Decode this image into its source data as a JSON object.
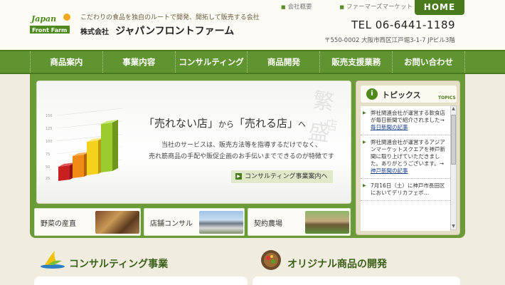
{
  "header": {
    "logo_text_top": "Japan",
    "logo_text_bottom": "Front Farm",
    "tagline": "こだわりの食品を独自のルートで開発、開拓して販売する会社",
    "company_prefix": "株式会社",
    "company_name": "ジャパンフロントファーム",
    "top_links": [
      "会社概要",
      "ファーマーズマーケット"
    ],
    "home": "HOME",
    "tel": "TEL 06-6441-1189",
    "address": "〒550-0002 大阪市西区江戸堀3-1-7 JPビル3階"
  },
  "nav": {
    "items": [
      "商品案内",
      "事業内容",
      "コンサルティング",
      "商品開発",
      "販売支援業務",
      "お問い合わせ"
    ]
  },
  "hero": {
    "stamp": "繁盛",
    "stamp2": "店",
    "headline_a": "「売れない店」",
    "headline_from": "から",
    "headline_b": "「売れる店」",
    "headline_to": "へ",
    "text_line1": "当社のサービスは、販売方法等を指導するだけでなく、",
    "text_line2": "売れ筋商品の手配や販促企画のお手伝いまでできるのが特徴です",
    "button": "コンサルティング事業案内へ",
    "chart_ticks": [
      "150",
      "125",
      "100",
      "75",
      "50",
      "25"
    ]
  },
  "subs": [
    {
      "label": "野菜の産直"
    },
    {
      "label": "店舗コンサル"
    },
    {
      "label": "契約農場"
    }
  ],
  "topics": {
    "title": "トピックス",
    "title_en": "TOPICS",
    "items": [
      {
        "text": "弊社関連会社が運営する軟食店が毎日新聞で紹介されました→",
        "link": "毎日新聞の記事"
      },
      {
        "text": "弊社関連会社が運営するアジアンマーケットスクエアを神戸新聞に取り上げていただきました。ありがとうございます。→",
        "link": "神戸新聞の記事"
      },
      {
        "text": "7月16日（土）に神戸市長田区においてデリカフェボ…",
        "link": ""
      }
    ]
  },
  "sections": [
    {
      "title": "コンサルティング事業"
    },
    {
      "title": "オリジナル商品の開発"
    }
  ],
  "colors": {
    "brand_green": "#5f9431",
    "dark_green": "#4a7a1e"
  }
}
